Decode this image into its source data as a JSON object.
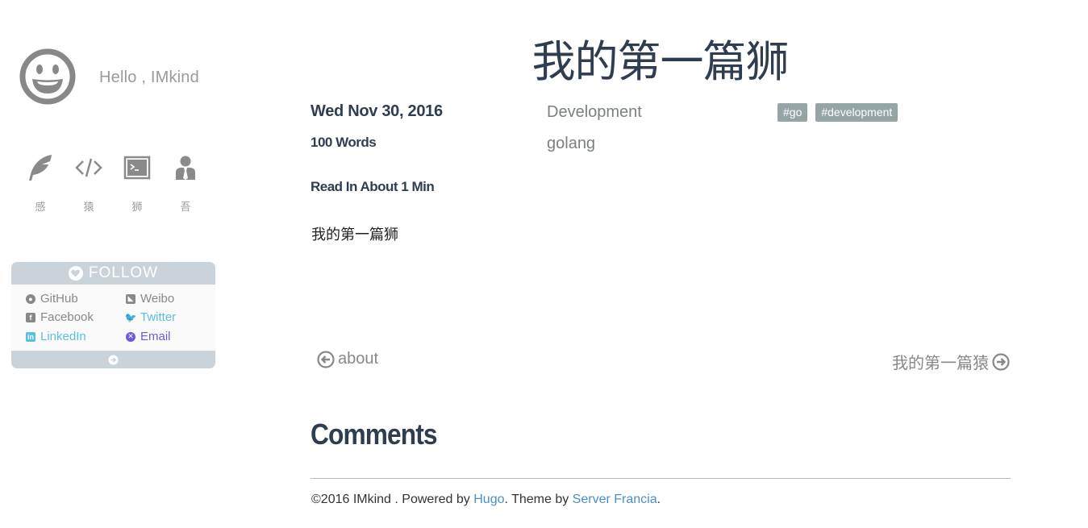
{
  "sidebar": {
    "greeting": "Hello , IMkind",
    "nav": [
      {
        "label": "感",
        "icon": "feather-icon"
      },
      {
        "label": "猿",
        "icon": "code-icon"
      },
      {
        "label": "狮",
        "icon": "terminal-icon"
      },
      {
        "label": "吾",
        "icon": "user-tie-icon"
      }
    ],
    "follow": {
      "title": "FOLLOW",
      "links": [
        {
          "label": "GitHub",
          "icon": "github-icon",
          "color": "#888888"
        },
        {
          "label": "Weibo",
          "icon": "rss-icon",
          "color": "#888888"
        },
        {
          "label": "Facebook",
          "icon": "facebook-icon",
          "color": "#888888"
        },
        {
          "label": "Twitter",
          "icon": "twitter-icon",
          "color": "#5bc0de"
        },
        {
          "label": "LinkedIn",
          "icon": "linkedin-icon",
          "color": "#5bc0de"
        },
        {
          "label": "Email",
          "icon": "email-icon",
          "color": "#6f5bd6"
        }
      ]
    }
  },
  "post": {
    "title": "我的第一篇狮",
    "date": "Wed Nov 30, 2016",
    "words": "100 Words",
    "read_time": "Read In About 1 Min",
    "summary": "我的第一篇狮",
    "categories": [
      "Development",
      "golang"
    ],
    "tags": [
      "#go",
      "#development"
    ]
  },
  "pager": {
    "prev": "about",
    "next": "我的第一篇猿"
  },
  "comments_heading": "Comments",
  "footer": {
    "copyright": "©2016 IMkind . Powered by ",
    "hugo": "Hugo",
    "theme_by": ". Theme by ",
    "theme": "Server Francia",
    "end": "."
  },
  "colors": {
    "title": "#2e3e50",
    "tag_bg": "#95a5a6",
    "follow_bar": "#cbd3da",
    "link": "#4a90c8"
  }
}
